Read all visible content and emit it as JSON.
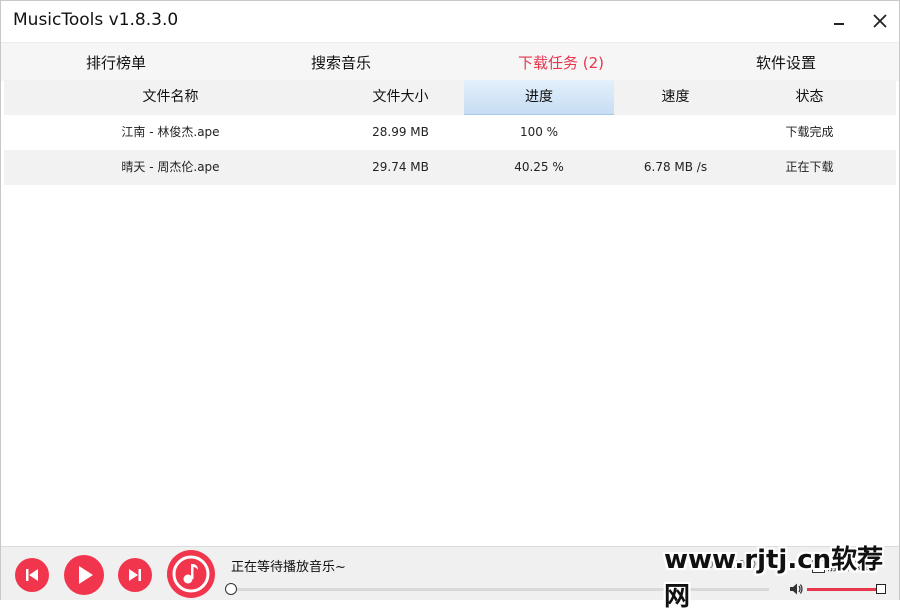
{
  "window": {
    "title": "MusicTools v1.8.3.0"
  },
  "tabs": [
    {
      "label": "排行榜单"
    },
    {
      "label": "搜索音乐"
    },
    {
      "label": "下载任务 (2)",
      "active": true
    },
    {
      "label": "软件设置"
    }
  ],
  "table": {
    "columns": [
      "文件名称",
      "文件大小",
      "进度",
      "速度",
      "状态"
    ],
    "rows": [
      {
        "name": "江南 - 林俊杰.ape",
        "size": "28.99 MB",
        "progress": "100 %",
        "speed": "",
        "status": "下载完成"
      },
      {
        "name": "晴天 - 周杰伦.ape",
        "size": "29.74 MB",
        "progress": "40.25 %",
        "speed": "6.78 MB /s",
        "status": "正在下载"
      }
    ]
  },
  "player": {
    "status_text": "正在等待播放音乐~",
    "time": "00:00 / 00:00",
    "mute_label": "静音模式",
    "seek_fraction": 0,
    "volume_fraction": 1.0,
    "icons": [
      "previous-icon",
      "play-icon",
      "next-icon",
      "music-note-icon",
      "volume-icon"
    ]
  },
  "watermark": "www.rjtj.cn软荐网",
  "colors": {
    "accent": "#e8364d",
    "button": "#f0354c",
    "selected_header": "#c7ddf3"
  }
}
